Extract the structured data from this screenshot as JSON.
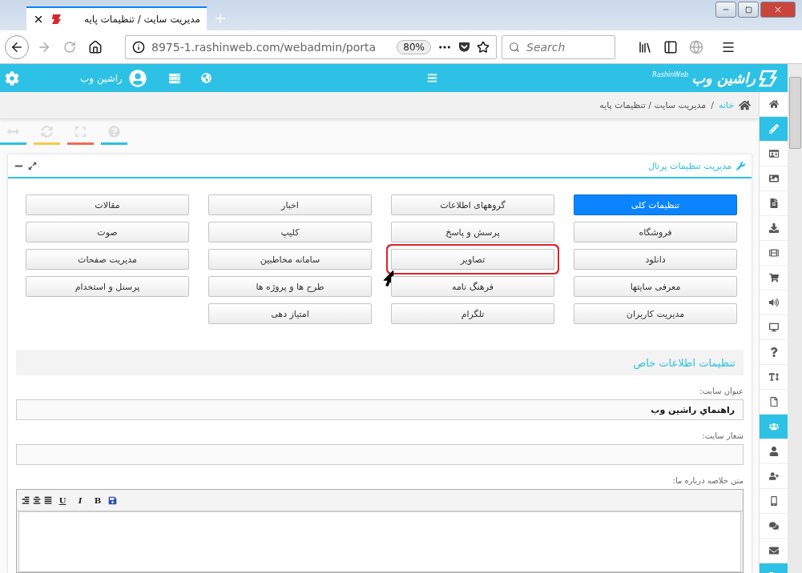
{
  "browser": {
    "tab_title": "مدیریت سایت / تنظیمات پایه",
    "url": "8975-1.rashinweb.com/webadmin/porta",
    "zoom": "80%",
    "search": {
      "placeholder": "Search"
    }
  },
  "header": {
    "logo_text": "راشین وب",
    "logo_subtext": "RashinWeb",
    "user_name": "راشین وب"
  },
  "breadcrumb": {
    "home": "خانه",
    "separator": "/",
    "current": "مدیریت سایت / تنظیمات پایه"
  },
  "tools": [
    {
      "color": "#2bc0e4"
    },
    {
      "color": "#f7c948"
    },
    {
      "color": "#f26c4f"
    },
    {
      "color": "#2bc0e4"
    }
  ],
  "panel": {
    "title": "مدیریت تنظیمات پرتال"
  },
  "modules": [
    {
      "label": "تنظیمات کلی",
      "selected": true,
      "highlighted": false
    },
    {
      "label": "گروههای اطلاعات",
      "selected": false,
      "highlighted": false
    },
    {
      "label": "اخبار",
      "selected": false,
      "highlighted": false
    },
    {
      "label": "مقالات",
      "selected": false,
      "highlighted": false
    },
    {
      "label": "فروشگاه",
      "selected": false,
      "highlighted": false
    },
    {
      "label": "پرسش و پاسخ",
      "selected": false,
      "highlighted": false
    },
    {
      "label": "کلیپ",
      "selected": false,
      "highlighted": false
    },
    {
      "label": "صوت",
      "selected": false,
      "highlighted": false
    },
    {
      "label": "دانلود",
      "selected": false,
      "highlighted": false
    },
    {
      "label": "تصاویر",
      "selected": false,
      "highlighted": true
    },
    {
      "label": "سامانه مخاطبین",
      "selected": false,
      "highlighted": false
    },
    {
      "label": "مدیریت صفحات",
      "selected": false,
      "highlighted": false
    },
    {
      "label": "معرفی سایتها",
      "selected": false,
      "highlighted": false
    },
    {
      "label": "فرهنگ نامه",
      "selected": false,
      "highlighted": false
    },
    {
      "label": "طرح ها و پروژه ها",
      "selected": false,
      "highlighted": false
    },
    {
      "label": "پرسنل و استخدام",
      "selected": false,
      "highlighted": false
    },
    {
      "label": "مدیریت کاربران",
      "selected": false,
      "highlighted": false
    },
    {
      "label": "تلگرام",
      "selected": false,
      "highlighted": false
    },
    {
      "label": "امتیاز دهی",
      "selected": false,
      "highlighted": false
    }
  ],
  "section": {
    "title": "تنظیمات اطلاعات خاص",
    "fields": [
      {
        "label": "عنوان سایت:",
        "value": "راهنماي راشين وب"
      },
      {
        "label": "شعار سایت:"
      }
    ],
    "editor": {
      "label": "متن خلاصه درباره ما:",
      "format_buttons": [
        "B",
        "I",
        "U"
      ]
    }
  },
  "sidebar": {
    "items": [
      {
        "selected": false
      },
      {
        "selected": true
      },
      {
        "selected": false
      },
      {
        "selected": false
      },
      {
        "selected": false
      },
      {
        "selected": false
      },
      {
        "selected": false
      },
      {
        "selected": false
      },
      {
        "selected": false
      },
      {
        "selected": false
      },
      {
        "selected": false
      },
      {
        "selected": false
      },
      {
        "selected": false
      },
      {
        "selected": true
      },
      {
        "selected": false
      },
      {
        "selected": false
      },
      {
        "selected": false
      },
      {
        "selected": false
      },
      {
        "selected": false
      },
      {
        "selected": true
      }
    ]
  }
}
